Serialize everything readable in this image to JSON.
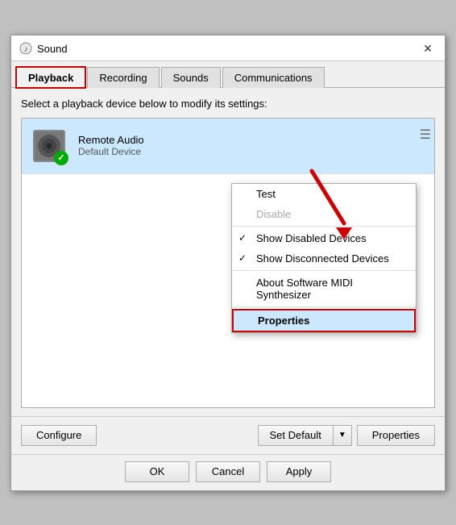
{
  "title": "Sound",
  "tabs": [
    {
      "id": "playback",
      "label": "Playback",
      "active": true
    },
    {
      "id": "recording",
      "label": "Recording",
      "active": false
    },
    {
      "id": "sounds",
      "label": "Sounds",
      "active": false
    },
    {
      "id": "communications",
      "label": "Communications",
      "active": false
    }
  ],
  "instruction": "Select a playback device below to modify its settings:",
  "device": {
    "name": "Remote Audio",
    "status": "Default Device"
  },
  "context_menu": {
    "items": [
      {
        "id": "test",
        "label": "Test",
        "disabled": false,
        "checked": false
      },
      {
        "id": "disable",
        "label": "Disable",
        "disabled": true,
        "checked": false
      },
      {
        "id": "show-disabled",
        "label": "Show Disabled Devices",
        "disabled": false,
        "checked": true
      },
      {
        "id": "show-disconnected",
        "label": "Show Disconnected Devices",
        "disabled": false,
        "checked": true
      },
      {
        "id": "about-midi",
        "label": "About Software MIDI Synthesizer",
        "disabled": false,
        "checked": false
      },
      {
        "id": "properties",
        "label": "Properties",
        "disabled": false,
        "checked": false,
        "highlighted": true
      }
    ]
  },
  "footer": {
    "configure_label": "Configure",
    "set_default_label": "Set Default",
    "properties_label": "Properties"
  },
  "buttons": {
    "ok_label": "OK",
    "cancel_label": "Cancel",
    "apply_label": "Apply"
  }
}
